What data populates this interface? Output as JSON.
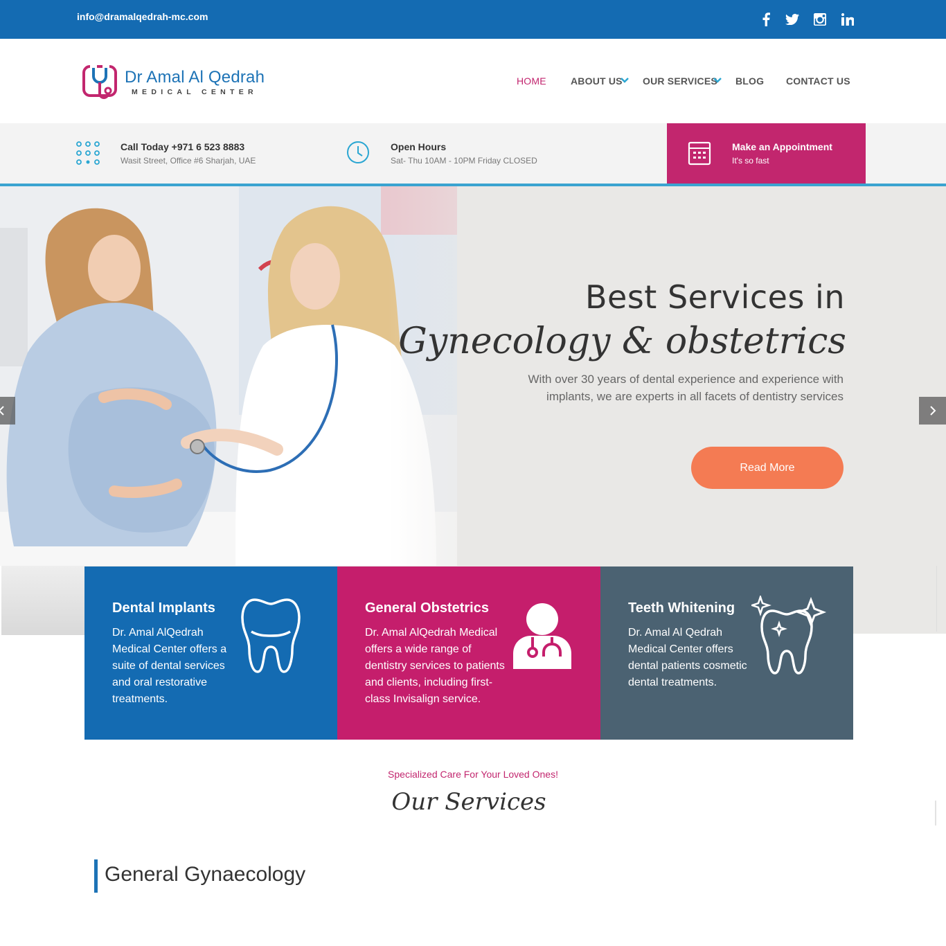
{
  "topbar": {
    "email": "info@dramalqedrah-mc.com",
    "social": [
      "facebook-icon",
      "twitter-icon",
      "instagram-icon",
      "linkedin-icon"
    ]
  },
  "logo": {
    "name": "Dr Amal Al Qedrah",
    "sub": "MEDICAL CENTER"
  },
  "nav": {
    "items": [
      {
        "label": "HOME",
        "active": true
      },
      {
        "label": "ABOUT US",
        "dropdown": true
      },
      {
        "label": "OUR SERVICES",
        "dropdown": true
      },
      {
        "label": "BLOG"
      },
      {
        "label": "CONTACT US"
      }
    ]
  },
  "info": {
    "call_title": "Call Today +971 6 523 8883",
    "call_sub": "Wasit Street, Office #6 Sharjah, UAE",
    "hours_title": "Open Hours",
    "hours_sub": "Sat- Thu 10AM - 10PM Friday CLOSED",
    "appt_title": "Make an Appointment",
    "appt_sub": "It's so fast"
  },
  "hero": {
    "line1": "Best Services in",
    "line2": "Gynecology & obstetrics",
    "text": "With over 30 years of dental experience and experience with implants, we are experts in all facets of dentistry services",
    "button": "Read More"
  },
  "cards": [
    {
      "title": "Dental Implants",
      "text": "Dr. Amal AlQedrah Medical Center offers a suite of dental services and oral restorative treatments.",
      "icon": "tooth-icon"
    },
    {
      "title": "General Obstetrics",
      "text": "Dr. Amal AlQedrah Medical offers a wide range of dentistry services to patients and clients, including first-class Invisalign service.",
      "icon": "doctor-icon"
    },
    {
      "title": "Teeth Whitening",
      "text": "Dr. Amal Al Qedrah Medical Center offers dental patients cosmetic dental treatments.",
      "icon": "sparkling-tooth-icon"
    }
  ],
  "colors": {
    "brand_blue": "#146bb2",
    "brand_pink": "#c2266e",
    "card_slate": "#4b6272",
    "cta_orange": "#f47b53"
  },
  "services": {
    "kicker": "Specialized Care For Your Loved Ones!",
    "title": "Our Services",
    "subheading": "General Gynaecology"
  }
}
